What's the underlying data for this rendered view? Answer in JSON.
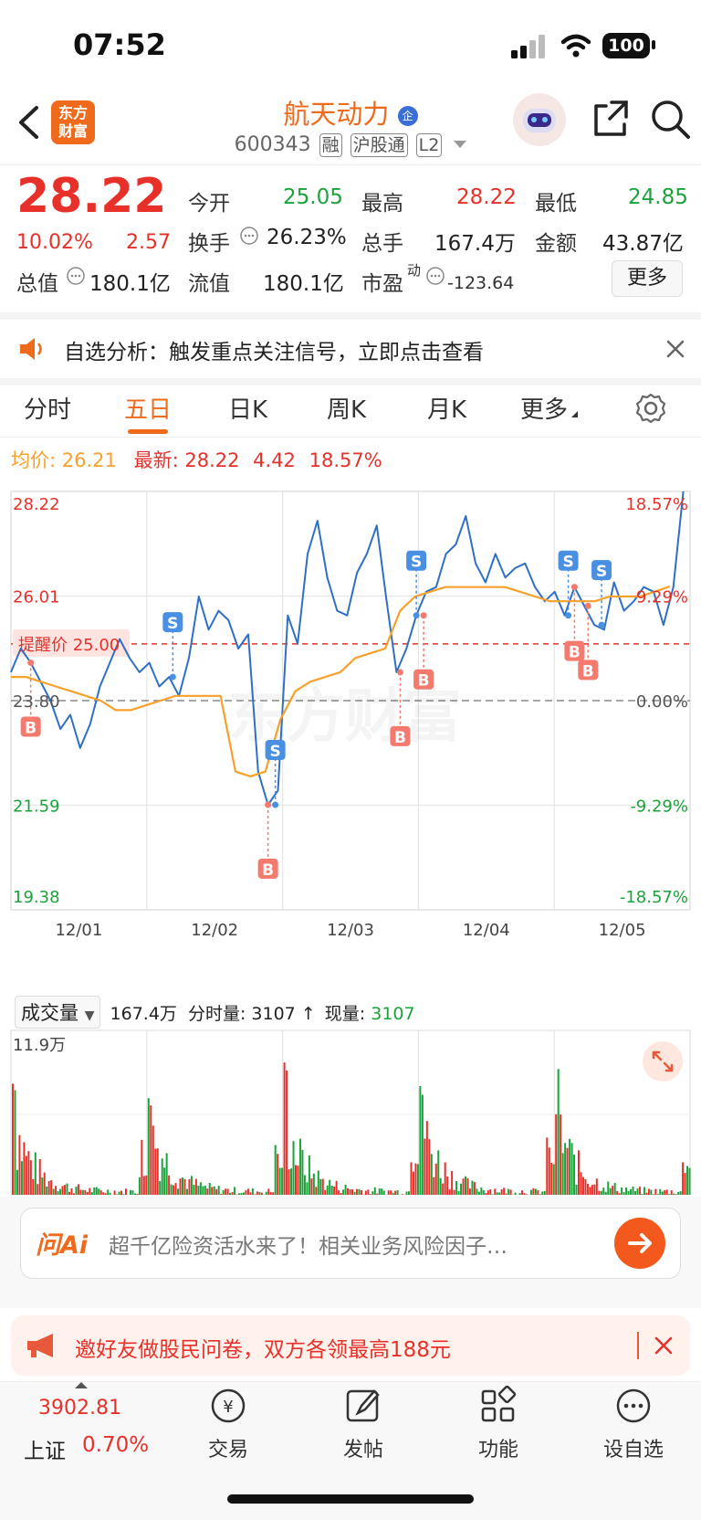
{
  "status": {
    "time": "07:52",
    "battery": "100"
  },
  "header": {
    "back_icon": "chevron-left-icon",
    "logo": "东方\n财富",
    "stock_name": "航天动力",
    "badge": "企",
    "stock_code": "600343",
    "tags": [
      "融",
      "沪股通",
      "L2"
    ],
    "share_icon": "share-icon",
    "search_icon": "search-icon"
  },
  "quote": {
    "price": "28.22",
    "change_pct": "10.02%",
    "change": "2.57",
    "open_label": "今开",
    "open": "25.05",
    "high_label": "最高",
    "high": "28.22",
    "low_label": "最低",
    "low": "24.85",
    "turnover_label": "换手",
    "turnover": "26.23%",
    "volume_label": "总手",
    "volume": "167.4万",
    "amount_label": "金额",
    "amount": "43.87亿",
    "mktcap_label": "总值",
    "mktcap": "180.1亿",
    "float_label": "流值",
    "float": "180.1亿",
    "pe_label": "市盈",
    "pe_sup": "动",
    "pe": "-123.64",
    "more_button": "更多"
  },
  "banner": {
    "text": "自选分析：触发重点关注信号，立即点击查看"
  },
  "tabs": [
    "分时",
    "五日",
    "日K",
    "周K",
    "月K",
    "更多"
  ],
  "active_tab": "五日",
  "info_line": {
    "avg_label": "均价:",
    "avg": "26.21",
    "latest_label": "最新:",
    "latest": "28.22",
    "change": "4.42",
    "change_pct": "18.57%"
  },
  "chart_data": {
    "type": "line",
    "title": "",
    "x_labels": [
      "12/01",
      "12/02",
      "12/03",
      "12/04",
      "12/05"
    ],
    "y_left_ticks": [
      "28.22",
      "26.01",
      "23.80",
      "21.59",
      "19.38"
    ],
    "y_right_ticks": [
      "18.57%",
      "9.29%",
      "0.00%",
      "-9.29%",
      "-18.57%"
    ],
    "ylim": [
      19.38,
      28.22
    ],
    "reference_price": 23.8,
    "alert_label": "提醒价 25.00",
    "alert_price": 25.0,
    "series": [
      {
        "name": "价格",
        "color": "#2f6fc4",
        "values": [
          24.4,
          24.9,
          24.6,
          24.2,
          23.8,
          23.2,
          23.5,
          22.8,
          23.3,
          24.1,
          24.6,
          25.1,
          24.7,
          24.4,
          24.6,
          24.1,
          24.3,
          23.9,
          24.7,
          26.0,
          25.3,
          25.7,
          25.5,
          24.9,
          25.2,
          22.3,
          21.6,
          21.9,
          25.6,
          25.0,
          26.9,
          27.6,
          26.4,
          25.7,
          25.6,
          26.5,
          26.9,
          27.5,
          25.9,
          24.4,
          24.9,
          25.6,
          26.1,
          26.2,
          26.9,
          27.1,
          27.7,
          26.7,
          26.3,
          26.9,
          26.4,
          26.6,
          26.7,
          26.2,
          25.9,
          26.1,
          25.6,
          26.2,
          25.8,
          25.4,
          25.3,
          26.3,
          25.7,
          25.9,
          26.2,
          26.1,
          25.4,
          26.2,
          28.22
        ]
      },
      {
        "name": "均价",
        "color": "#f5a12b",
        "values": [
          24.3,
          24.3,
          24.2,
          24.1,
          24.0,
          23.9,
          23.8,
          23.6,
          23.6,
          23.7,
          23.8,
          23.9,
          23.9,
          23.9,
          23.9,
          22.3,
          22.2,
          22.3,
          23.4,
          24.0,
          24.2,
          24.3,
          24.4,
          24.7,
          24.8,
          24.9,
          25.7,
          26.0,
          26.1,
          26.2,
          26.2,
          26.2,
          26.2,
          26.2,
          26.1,
          26.0,
          25.9,
          25.9,
          25.9,
          25.9,
          26.0,
          26.0,
          26.0,
          26.1,
          26.21
        ]
      }
    ],
    "markers": [
      {
        "label": "B",
        "type": "buy"
      },
      {
        "label": "S",
        "type": "sell"
      },
      {
        "label": "S",
        "type": "sell"
      },
      {
        "label": "B",
        "type": "buy"
      },
      {
        "label": "B",
        "type": "buy"
      },
      {
        "label": "B",
        "type": "buy"
      },
      {
        "label": "S",
        "type": "sell"
      },
      {
        "label": "S",
        "type": "sell"
      },
      {
        "label": "S",
        "type": "sell"
      },
      {
        "label": "B",
        "type": "buy"
      },
      {
        "label": "B",
        "type": "buy"
      }
    ],
    "grid": true,
    "watermark": "东方财富"
  },
  "volume": {
    "select_label": "成交量",
    "total": "167.4万",
    "minute_label": "分时量:",
    "minute": "3107",
    "arrow": "↑",
    "current_label": "现量:",
    "current": "3107",
    "max_label": "11.9万",
    "expand_icon": "expand-icon"
  },
  "ai": {
    "logo": "问Ai",
    "text": "超千亿险资活水来了！相关业务风险因子…"
  },
  "invite": {
    "text": "邀好友做股民问卷，双方各领最高188元"
  },
  "bottom_nav": {
    "index_value": "3902.81",
    "index_name": "上证",
    "index_pct": "0.70%",
    "items": [
      {
        "label": "交易",
        "icon": "trade-icon"
      },
      {
        "label": "发帖",
        "icon": "post-icon"
      },
      {
        "label": "功能",
        "icon": "apps-icon"
      },
      {
        "label": "设自选",
        "icon": "more-icon"
      }
    ]
  }
}
